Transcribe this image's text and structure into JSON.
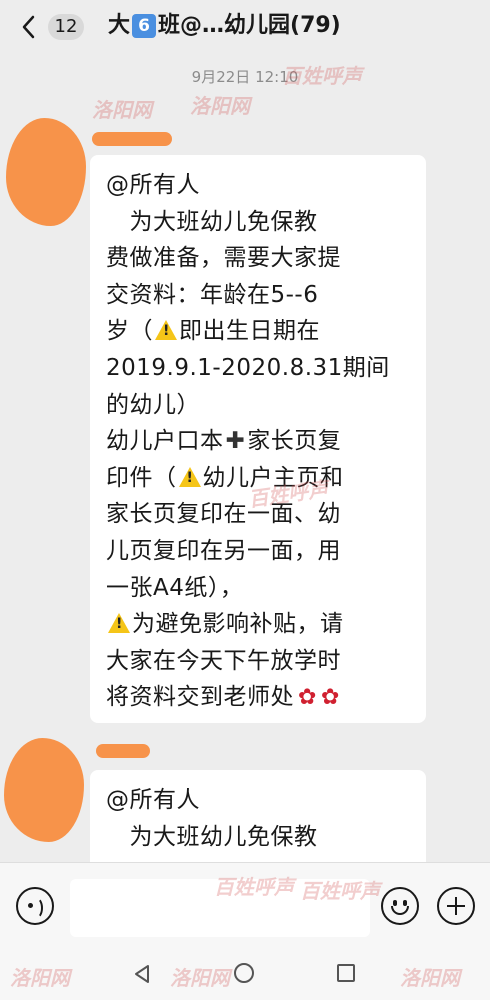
{
  "header": {
    "unread_count": "12",
    "title_prefix": "大",
    "title_digit": "6",
    "title_suffix": "班@…幼儿园(79)"
  },
  "timestamp": "9月22日 12:10",
  "messages": [
    {
      "lines": [
        "@所有人",
        "　为大班幼儿免保教",
        "费做准备，需要大家提",
        "交资料：年龄在5--6",
        [
          "岁（",
          "warn",
          "即出生日期在"
        ],
        "2019.9.1-2020.8.31期间",
        "的幼儿）",
        [
          "幼儿户口本",
          "plus",
          "家长页复"
        ],
        [
          "印件（",
          "warn",
          "幼儿户主页和"
        ],
        "家长页复印在一面、幼",
        "儿页复印在另一面，用",
        "一张A4纸），",
        [
          "",
          "warn",
          "为避免影响补贴，请"
        ],
        "大家在今天下午放学时",
        [
          "将资料交到老师处",
          "rose",
          "rose"
        ]
      ]
    },
    {
      "lines": [
        "@所有人",
        "　为大班幼儿免保教"
      ]
    }
  ],
  "watermarks": [
    "洛阳网",
    "百姓呼声"
  ],
  "input": {
    "placeholder": ""
  },
  "icons": {
    "back": "chevron-left-icon",
    "voice": "voice-icon",
    "emoji": "emoji-icon",
    "more": "plus-circle-icon",
    "warning": "warning-icon",
    "heavy_plus": "plus-icon",
    "rose": "rose-icon"
  },
  "colors": {
    "background": "#ededed",
    "bubble": "#ffffff",
    "avatar_redaction": "#f7934a",
    "watermark": "#d25050"
  }
}
